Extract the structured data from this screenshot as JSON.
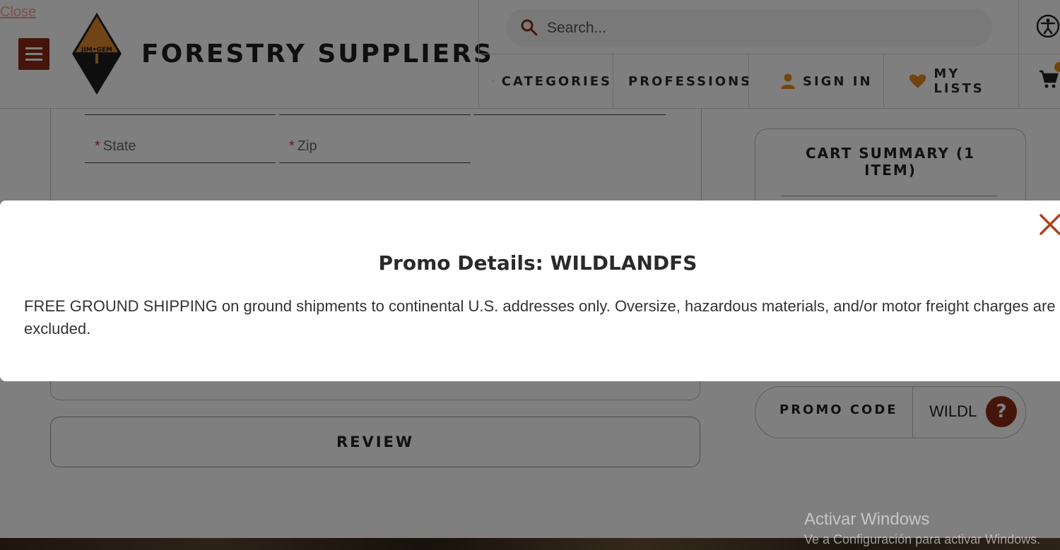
{
  "header": {
    "skip_close": "Close",
    "brand_name": "FORESTRY SUPPLIERS",
    "logo_text": "JIM•GEM",
    "search": {
      "placeholder": "Search..."
    },
    "nav": [
      {
        "label": "CATEGORIES",
        "icon": "categories-menu-icon"
      },
      {
        "label": "PROFESSIONS",
        "icon": "professions-menu-icon"
      },
      {
        "label": "SIGN IN",
        "icon": "user-icon"
      },
      {
        "label": "MY LISTS",
        "icon": "heart-icon"
      }
    ],
    "colors": {
      "brand_dark": "#8a2a16",
      "accent_orange": "#e58a1f"
    }
  },
  "form": {
    "state_label": "State",
    "zip_label": "Zip",
    "required_marker": "*",
    "review_button": "REVIEW"
  },
  "cart_summary": {
    "title": "CART SUMMARY (1 ITEM)"
  },
  "promo": {
    "label": "PROMO CODE",
    "value": "WILDL",
    "help_symbol": "?"
  },
  "modal": {
    "title": "Promo Details: WILDLANDFS",
    "body": "FREE GROUND SHIPPING on ground shipments to continental U.S. addresses only. Oversize, hazardous materials, and/or motor freight charges are excluded."
  },
  "watermark": {
    "line1": "Activar Windows",
    "line2": "Ve a Configuración para activar Windows."
  }
}
